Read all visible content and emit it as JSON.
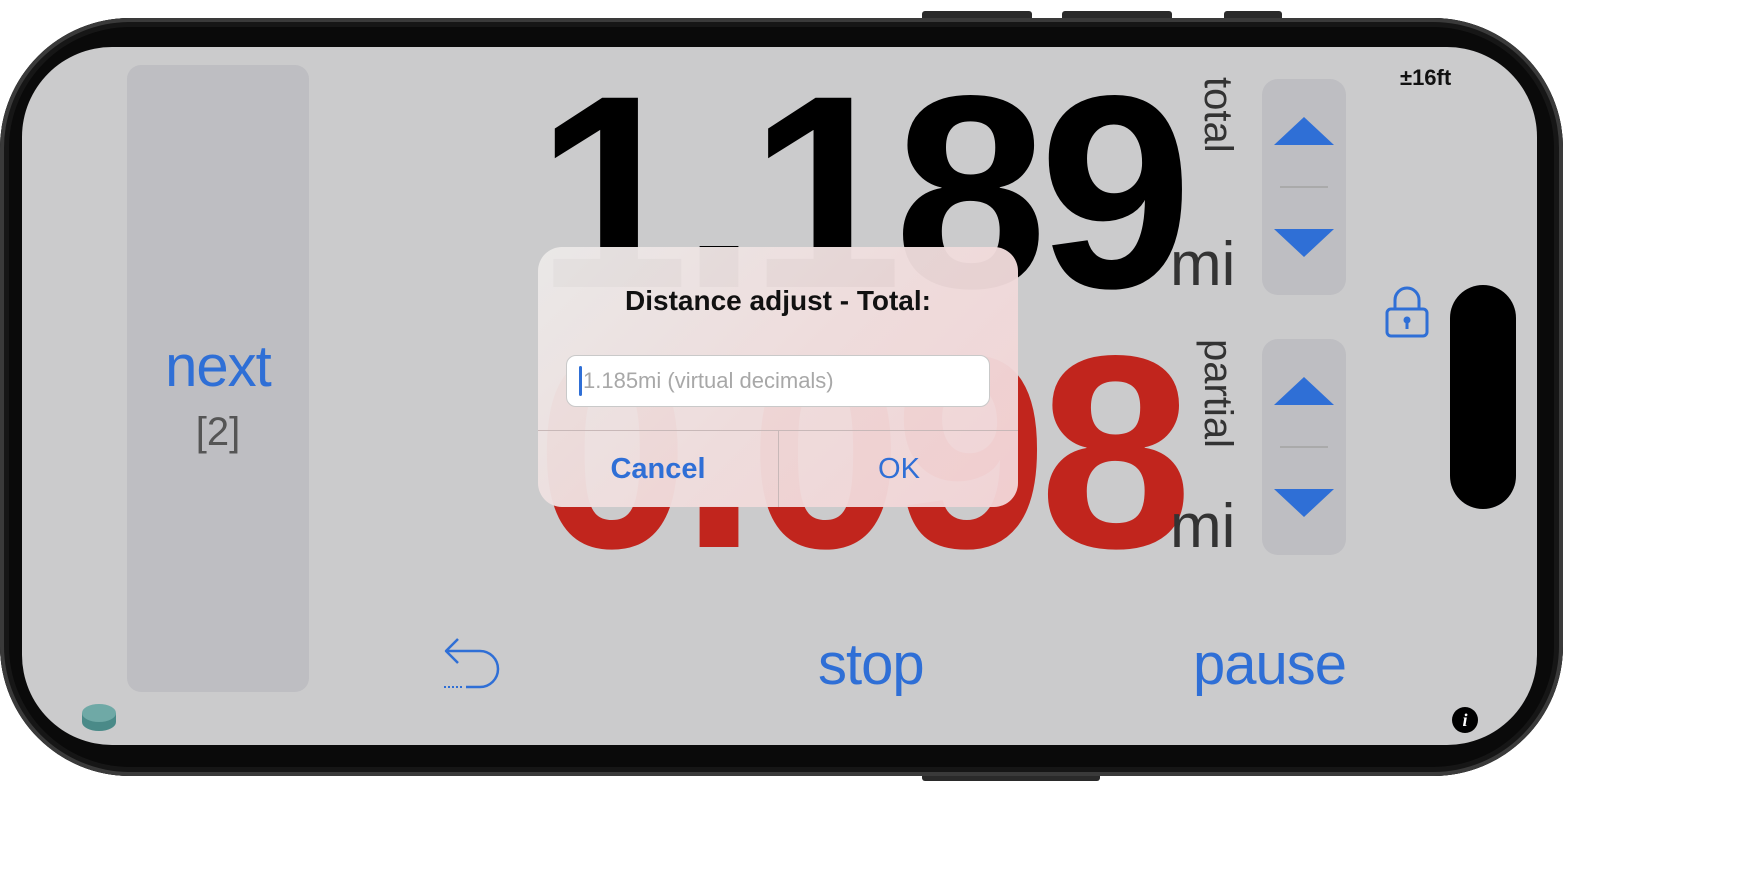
{
  "frame": {
    "color": "#0a0a0a"
  },
  "next_panel": {
    "label": "next",
    "count": "[2]"
  },
  "odometer": {
    "total": {
      "value": "1.189",
      "unit": "mi",
      "label": "total",
      "color": "#000000"
    },
    "partial": {
      "value": "0.098",
      "unit": "mi",
      "label": "partial",
      "color": "#c1251d"
    }
  },
  "tolerance": "±16ft",
  "controls": {
    "stop_label": "stop",
    "pause_label": "pause"
  },
  "dialog": {
    "title": "Distance adjust - Total:",
    "input_value": "",
    "input_placeholder": "1.185mi (virtual decimals)",
    "cancel_label": "Cancel",
    "ok_label": "OK"
  },
  "icons": {
    "undo": "undo-arrow-icon",
    "lock": "lock-icon",
    "info": "info-icon",
    "disc": "disc-icon",
    "arrow_up": "triangle-up-icon",
    "arrow_down": "triangle-down-icon"
  },
  "colors": {
    "accent": "#2f6fd6",
    "partial": "#c1251d",
    "screen_bg": "#cbcbcc"
  }
}
